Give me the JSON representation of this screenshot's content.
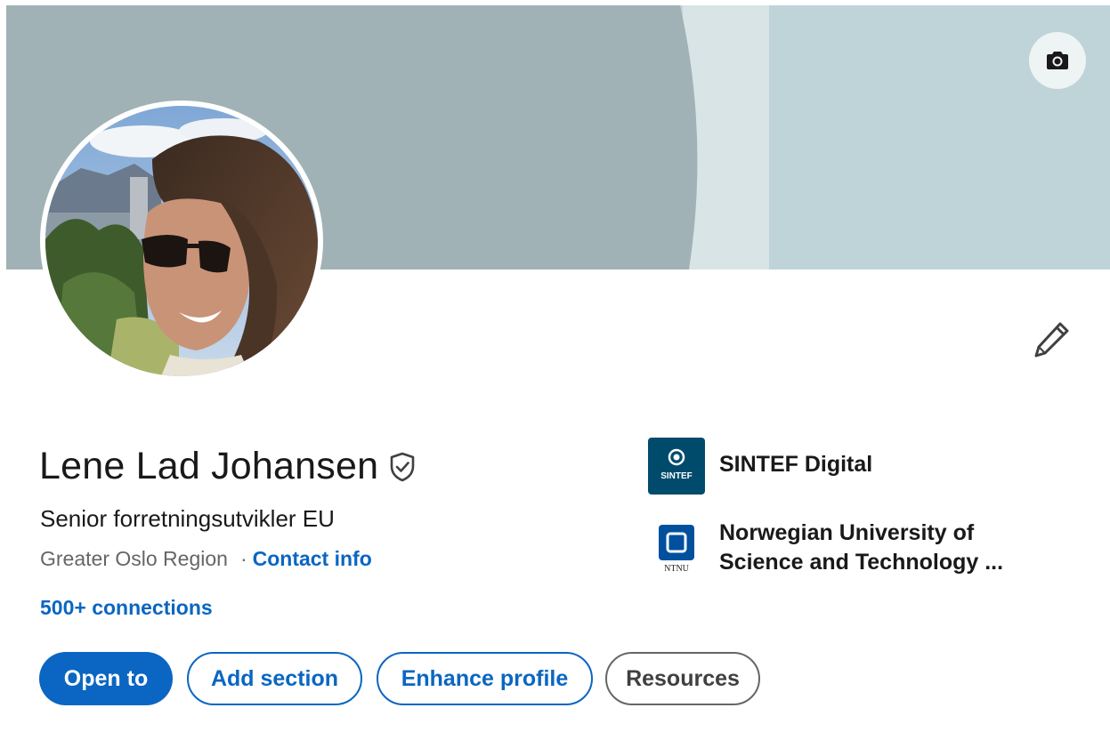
{
  "banner": {
    "colors": {
      "left": "#a0b2b5",
      "middle": "#d8e4e6",
      "right": "#bfd4d8"
    },
    "camera_icon": "camera-icon"
  },
  "profile": {
    "name": "Lene Lad Johansen",
    "verified_icon": "verified-shield-icon",
    "headline": "Senior forretningsutvikler EU",
    "location": "Greater Oslo Region",
    "separator": "·",
    "contact_info_label": "Contact info",
    "connections_label": "500+ connections"
  },
  "edit_icon": "pencil-icon",
  "actions": {
    "open_to": "Open to",
    "add_section": "Add section",
    "enhance_profile": "Enhance profile",
    "resources": "Resources"
  },
  "organizations": [
    {
      "name": "SINTEF Digital",
      "logo_text": "SINTEF",
      "logo_color": "#004b6b"
    },
    {
      "name": "Norwegian University of Science and Technology ...",
      "logo_text": "NTNU",
      "logo_color": "#00509e"
    }
  ],
  "colors": {
    "accent": "#0a66c2",
    "text": "#191919",
    "muted": "#666666"
  }
}
